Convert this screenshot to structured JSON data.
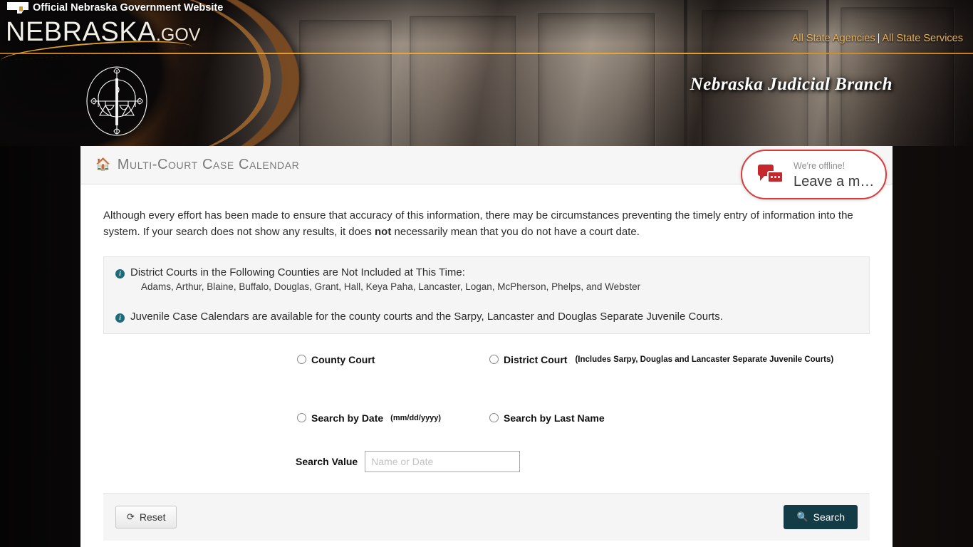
{
  "gov_bar": {
    "official_text": "Official Nebraska Government Website",
    "logo_main": "NEBRASKA",
    "logo_suffix": ".GOV",
    "links": [
      {
        "label": "All State Agencies"
      },
      {
        "label": "All State Services"
      }
    ],
    "separator": "|"
  },
  "masthead": {
    "branch_title_parts": [
      "N",
      "EBRASKA",
      " J",
      "UDICIAL",
      " B",
      "RANCH"
    ],
    "branch_title": "Nebraska Judicial Branch",
    "seal_alt": "Nebraska Judicial Branch seal"
  },
  "panel": {
    "title": "Multi-Court Case Calendar",
    "home_icon": "home-icon"
  },
  "chat": {
    "status": "We're offline!",
    "action": "Leave a m…",
    "icon": "chat-bubbles-icon"
  },
  "disclaimer": {
    "part1": "Although every effort has been made to ensure that accuracy of this information, there may be circumstances preventing the timely entry of information into the system. If your search does not show any results, it does ",
    "bold": "not",
    "part2": " necessarily mean that you do not have a court date."
  },
  "info": {
    "district_heading": "District Courts in the Following Counties are Not Included at This Time:",
    "counties_text": "Adams, Arthur, Blaine, Buffalo, Douglas, Grant, Hall, Keya Paha, Lancaster, Logan, McPherson, Phelps, and Webster",
    "counties": [
      "Adams",
      "Arthur",
      "Blaine",
      "Buffalo",
      "Douglas",
      "Grant",
      "Hall",
      "Keya Paha",
      "Lancaster",
      "Logan",
      "McPherson",
      "Phelps",
      "Webster"
    ],
    "juvenile_note": "Juvenile Case Calendars are available for the county courts and the Sarpy, Lancaster and Douglas Separate Juvenile Courts."
  },
  "form": {
    "court_type": {
      "county": {
        "label": "County Court",
        "selected": false
      },
      "district": {
        "label": "District Court",
        "note": "(Includes Sarpy, Douglas and Lancaster Separate Juvenile Courts)",
        "selected": false
      }
    },
    "search_type": {
      "date": {
        "label": "Search by Date",
        "note": "(mm/dd/yyyy)",
        "selected": false
      },
      "name": {
        "label": "Search by Last Name",
        "selected": false
      }
    },
    "search_value": {
      "label": "Search Value",
      "placeholder": "Name or Date",
      "value": ""
    }
  },
  "footer": {
    "reset_label": "Reset",
    "reset_icon": "refresh-icon",
    "search_label": "Search",
    "search_icon": "magnifier-icon"
  },
  "colors": {
    "gov_gold": "#e8b45c",
    "search_button": "#143c46",
    "chat_red": "#d93b3b",
    "info_icon": "#1b6b7d",
    "panel_bg": "#ffffff"
  }
}
